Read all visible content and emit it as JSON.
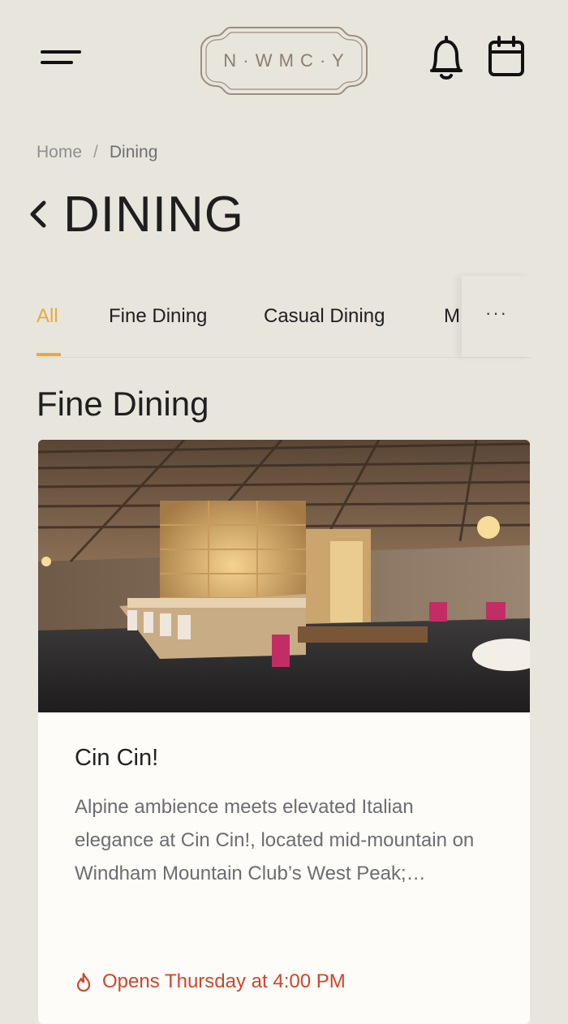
{
  "header": {
    "menu_icon": "hamburger-menu-icon",
    "logo_text": "N · W M C · Y",
    "notifications_icon": "bell-icon",
    "calendar_icon": "calendar-icon"
  },
  "breadcrumb": {
    "home": "Home",
    "separator": "/",
    "current": "Dining"
  },
  "page": {
    "back_icon": "chevron-left-icon",
    "title": "DINING"
  },
  "tabs": {
    "items": [
      {
        "label": "All",
        "active": true
      },
      {
        "label": "Fine Dining",
        "active": false
      },
      {
        "label": "Casual Dining",
        "active": false
      },
      {
        "label": "M",
        "active": false
      }
    ],
    "more_label": "···"
  },
  "section": {
    "title": "Fine Dining"
  },
  "card": {
    "name": "Cin Cin!",
    "description": "Alpine ambience meets elevated Italian elegance at Cin Cin!, located mid-mountain on Windham Mountain Club’s West Peak;…",
    "status": "Opens Thursday at 4:00 PM",
    "status_icon": "flame-icon"
  },
  "colors": {
    "background": "#e8e5dd",
    "accent": "#e8ab3a",
    "status": "#d0452a",
    "card": "#fdfcf8"
  }
}
